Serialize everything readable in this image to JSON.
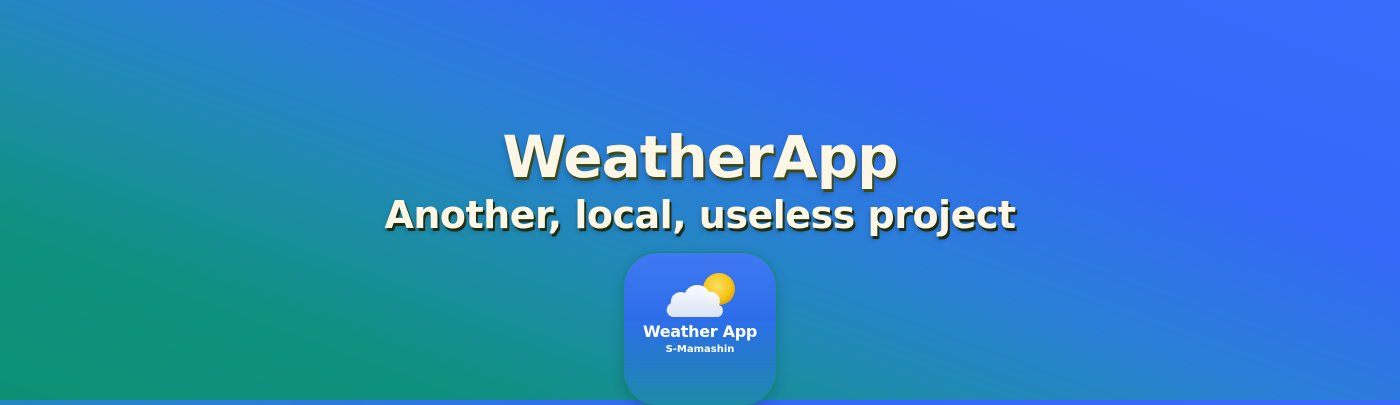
{
  "banner": {
    "title": "WeatherApp",
    "subtitle": "Another, local, useless project"
  },
  "app_icon": {
    "title": "Weather App",
    "subtitle": "S-Mamashin",
    "glyph": "cloud-sun-icon"
  },
  "colors": {
    "gradient_blue": "#3568f8",
    "gradient_teal": "#0a9174",
    "title_text": "#fbf7e4",
    "sun": "#f5c518",
    "cloud": "#eef3fb"
  }
}
